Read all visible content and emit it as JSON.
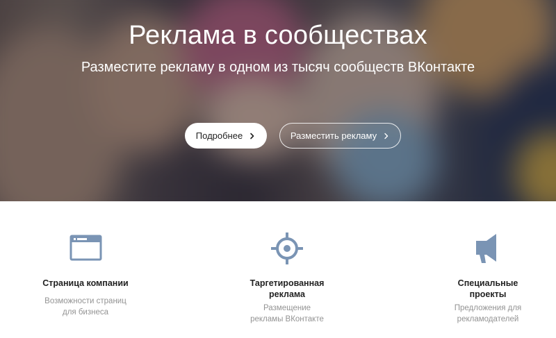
{
  "hero": {
    "title": "Реклама в сообществах",
    "subtitle": "Разместите рекламу в одном из тысяч сообществ ВКонтакте",
    "more_button": "Подробнее",
    "place_button": "Разместить рекламу"
  },
  "features": [
    {
      "icon": "browser-window-icon",
      "title": "Страница компании",
      "desc": "Возможности страниц для бизнеса"
    },
    {
      "icon": "target-icon",
      "title": "Таргетированная реклама",
      "desc": "Размещение рекламы ВКонтакте"
    },
    {
      "icon": "megaphone-icon",
      "title": "Специальные проекты",
      "desc": "Предложения для рекламодателей"
    }
  ],
  "colors": {
    "icon": "#7a94b4",
    "title_text": "#222222",
    "desc_text": "#939393"
  }
}
